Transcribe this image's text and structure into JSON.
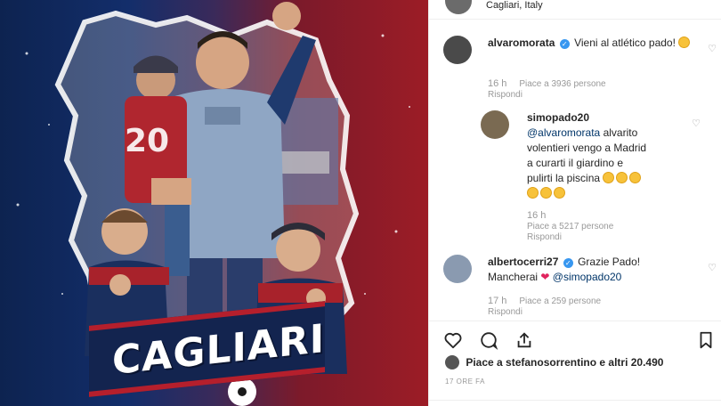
{
  "post": {
    "image_text": "CAGLIARI",
    "location": "Cagliari, Italy"
  },
  "comments": [
    {
      "username": "alvaromorata",
      "verified": true,
      "text": "Vieni al atlético pado!",
      "time": "16 h",
      "likes": "Piace a 3936 persone",
      "reply": "Rispondi"
    },
    {
      "username": "simopado20",
      "mention": "@alvaromorata",
      "text_line1": "alvarito",
      "text_line2": "volentieri vengo a Madrid",
      "text_line3": "a curarti il giardino e",
      "text_line4": "pulirti la piscina",
      "time": "16 h",
      "likes": "Piace a 5217 persone",
      "reply": "Rispondi"
    },
    {
      "username": "albertocerri27",
      "verified": true,
      "text_line1": "Grazie Pado!",
      "text_line2": "Mancherai",
      "mention": "@simopado20",
      "time": "17 h",
      "likes": "Piace a 259 persone",
      "reply": "Rispondi"
    }
  ],
  "actions": {
    "liked_by": "Piace a stefanosorrentino e altri 20.490",
    "timestamp": "17 ORE FA"
  },
  "icons": {
    "like": "heart-outline-icon",
    "comment": "comment-bubble-icon",
    "share": "share-icon",
    "save": "bookmark-icon"
  },
  "colors": {
    "verified": "#3897f0",
    "brand_red": "#b51f2c",
    "brand_navy": "#13244f",
    "heart_emoji": "#e0245e"
  }
}
